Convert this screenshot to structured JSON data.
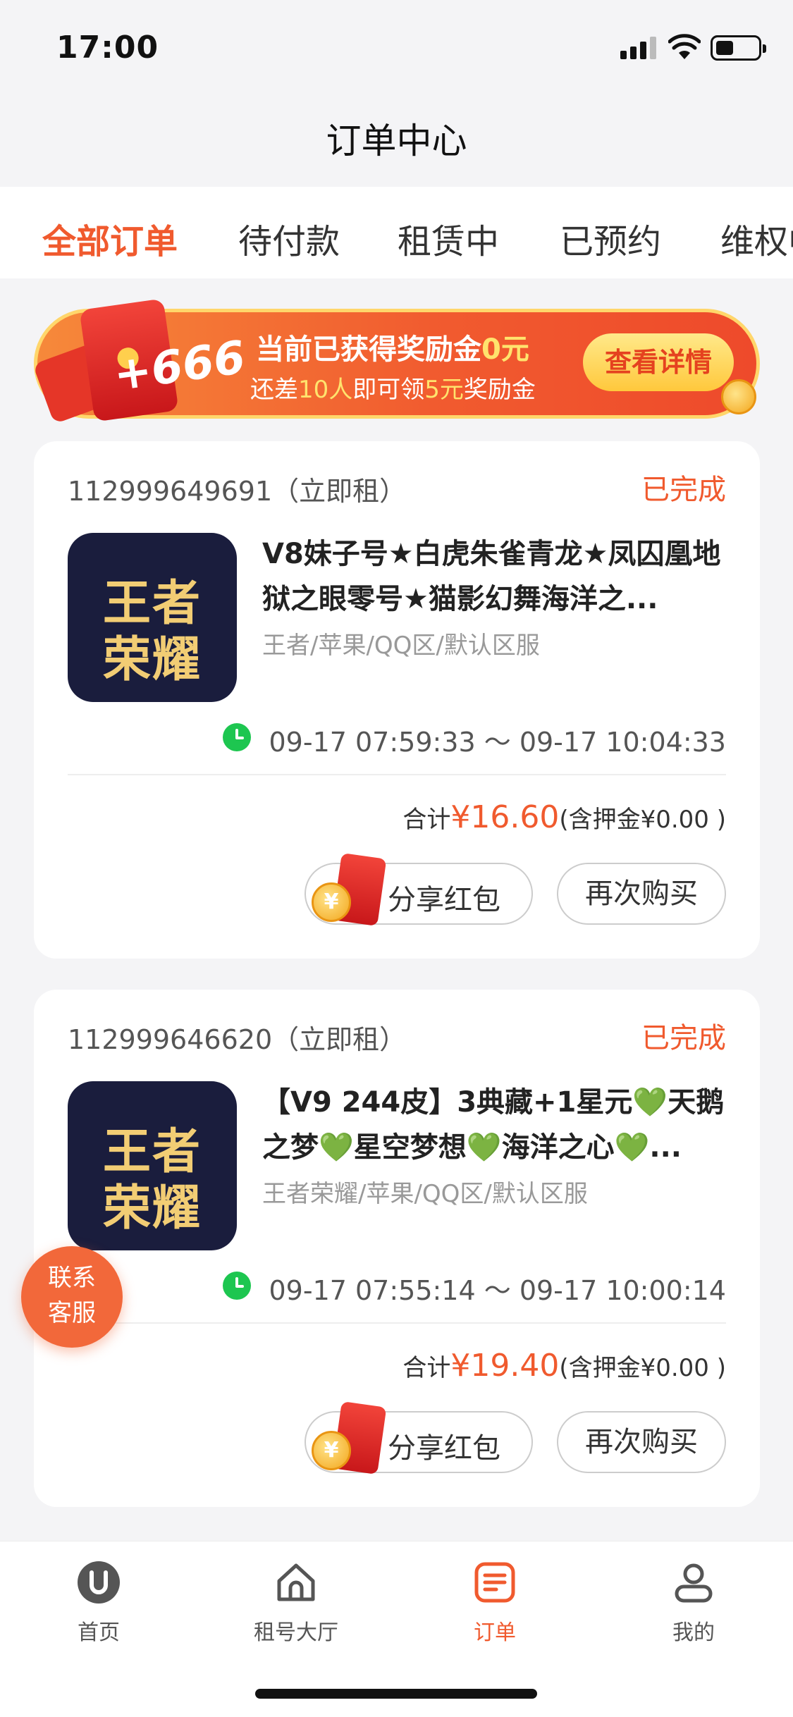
{
  "status_bar": {
    "time": "17:00"
  },
  "header": {
    "title": "订单中心"
  },
  "tabs": [
    {
      "label": "全部订单",
      "active": true
    },
    {
      "label": "待付款",
      "active": false
    },
    {
      "label": "租赁中",
      "active": false
    },
    {
      "label": "已预约",
      "active": false
    },
    {
      "label": "维权中",
      "active": false
    }
  ],
  "banner": {
    "plus_text": "+666",
    "line1_prefix": "当前已获得奖励金",
    "line1_amount": "0元",
    "line2_prefix": "还差",
    "line2_count": "10人",
    "line2_middle": "即可领",
    "line2_amount": "5元",
    "line2_suffix": "奖励金",
    "button": "查看详情"
  },
  "orders": [
    {
      "order_no": "112999649691（立即租）",
      "status": "已完成",
      "thumb_line1": "王者",
      "thumb_line2": "荣耀",
      "title": "V8妹子号★白虎朱雀青龙★凤囚凰地狱之眼零号★猫影幻舞海洋之...",
      "subtitle": "王者/苹果/QQ区/默认区服",
      "time_range": "09-17 07:59:33 ～ 09-17 10:04:33",
      "total_label": "合计",
      "price": "¥16.60",
      "deposit": "(含押金¥0.00 )",
      "share_label": "分享红包",
      "rebuy_label": "再次购买"
    },
    {
      "order_no": "112999646620（立即租）",
      "status": "已完成",
      "thumb_line1": "王者",
      "thumb_line2": "荣耀",
      "title": "【V9 244皮】3典藏+1星元💚天鹅之梦💚星空梦想💚海洋之心💚...",
      "subtitle": "王者荣耀/苹果/QQ区/默认区服",
      "time_range": "09-17 07:55:14 ～ 09-17 10:00:14",
      "total_label": "合计",
      "price": "¥19.40",
      "deposit": "(含押金¥0.00 )",
      "share_label": "分享红包",
      "rebuy_label": "再次购买"
    }
  ],
  "float_service": {
    "line1": "联系",
    "line2": "客服"
  },
  "bottom_nav": [
    {
      "label": "首页",
      "icon": "u-logo-icon",
      "active": false
    },
    {
      "label": "租号大厅",
      "icon": "house-icon",
      "active": false
    },
    {
      "label": "订单",
      "icon": "order-icon",
      "active": true
    },
    {
      "label": "我的",
      "icon": "user-icon",
      "active": false
    }
  ],
  "colors": {
    "accent": "#f05a2e",
    "green": "#1dc650",
    "gold": "#f2cd74"
  }
}
